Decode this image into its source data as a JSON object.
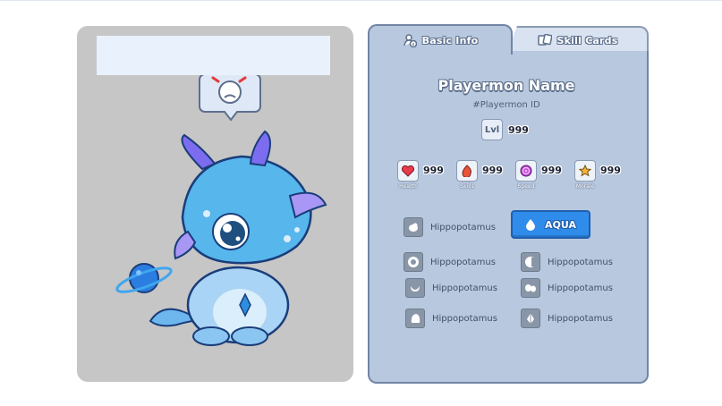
{
  "colors": {
    "panel": "#b8c8de",
    "panel_border": "#7185a4",
    "type_button": "#2f8cea",
    "card_bg": "#c6c6c6",
    "name_box": "#e9f2fc"
  },
  "tabs": [
    {
      "label": "Basic Info",
      "icon": "person-info-icon",
      "active": true
    },
    {
      "label": "Skill Cards",
      "icon": "cards-icon",
      "active": false
    }
  ],
  "playermon": {
    "name": "Playermon Name",
    "id": "#Playermon ID",
    "level_label": "Lvl",
    "level_value": "999"
  },
  "stats": [
    {
      "label": "Health",
      "value": "999",
      "icon": "heart-icon"
    },
    {
      "label": "Skills",
      "value": "999",
      "icon": "flame-icon"
    },
    {
      "label": "Speed",
      "value": "999",
      "icon": "spiral-icon"
    },
    {
      "label": "Morale",
      "value": "999",
      "icon": "star-icon"
    }
  ],
  "type": {
    "label": "AQUA",
    "icon": "water-drop-icon"
  },
  "attributes": [
    {
      "label": "Hippopotamus",
      "icon": "body-part-icon"
    },
    {
      "label": "Hippopotamus",
      "icon": "eye-part-icon"
    },
    {
      "label": "Hippopotamus",
      "icon": "head-part-icon"
    },
    {
      "label": "Hippopotamus",
      "icon": "mouth-part-icon"
    },
    {
      "label": "Hippopotamus",
      "icon": "ears-part-icon"
    },
    {
      "label": "Hippopotamus",
      "icon": "back-part-icon"
    },
    {
      "label": "Hippopotamus",
      "icon": "horn-part-icon"
    }
  ]
}
